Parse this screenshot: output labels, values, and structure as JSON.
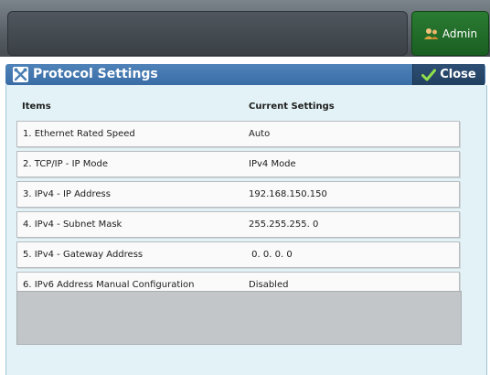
{
  "header": {
    "admin_label": "Admin"
  },
  "dialog": {
    "title": "Protocol Settings",
    "close_label": "Close",
    "columns": {
      "items": "Items",
      "current": "Current Settings"
    },
    "rows": [
      {
        "item": "1. Ethernet Rated Speed",
        "value": "Auto"
      },
      {
        "item": "2. TCP/IP - IP Mode",
        "value": "IPv4 Mode"
      },
      {
        "item": "3. IPv4 - IP Address",
        "value": "192.168.150.150"
      },
      {
        "item": "4. IPv4 - Subnet Mask",
        "value": "255.255.255. 0"
      },
      {
        "item": "5. IPv4 - Gateway Address",
        "value": " 0. 0. 0. 0"
      },
      {
        "item": "6. IPv6 Address Manual Configuration",
        "value": "Disabled"
      }
    ]
  },
  "icons": {
    "admin": "admin-user-icon",
    "title": "tools-icon",
    "close": "checkmark-icon"
  },
  "colors": {
    "accent_green": "#1f6b28",
    "title_blue": "#3f74ad",
    "panel_bg": "#e3f2f6"
  }
}
